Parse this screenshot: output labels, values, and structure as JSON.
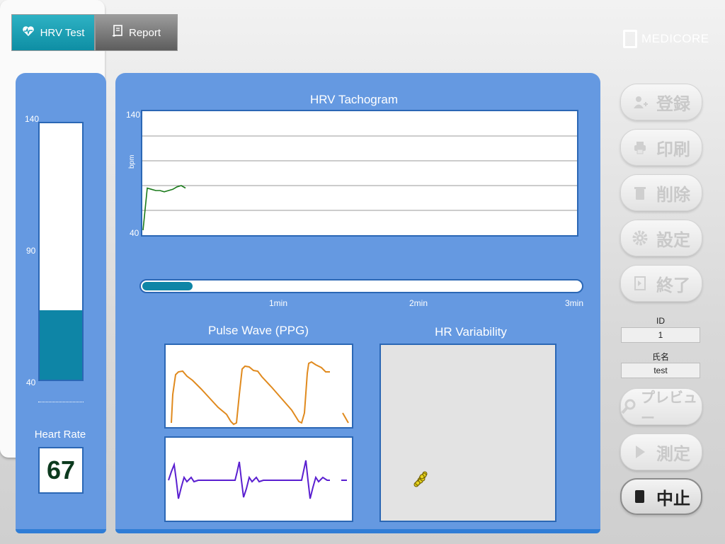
{
  "tabs": [
    {
      "label": "HRV Test",
      "icon": "heart-pulse-icon",
      "active": true
    },
    {
      "label": "Report",
      "icon": "document-icon",
      "active": false
    }
  ],
  "brand": {
    "name": "MEDICORE"
  },
  "heart_rate_panel": {
    "scale_max": "140",
    "scale_mid": "90",
    "scale_min": "40",
    "title": "Heart Rate",
    "value": "67",
    "gauge_level_bpm": 67
  },
  "tachogram": {
    "title": "HRV Tachogram",
    "ylabel": "bpm",
    "ymax": "140",
    "ymin": "40",
    "series_bpm": [
      44,
      78,
      77,
      76,
      76,
      75,
      76,
      77,
      79,
      80,
      78
    ]
  },
  "progress": {
    "fraction": 0.12,
    "ticks": [
      "1min",
      "2min",
      "3min"
    ]
  },
  "pulse_wave": {
    "title": "Pulse Wave (PPG)"
  },
  "hr_variability": {
    "title": "HR Variability"
  },
  "buttons": [
    {
      "label": "登録",
      "icon": "user-add-icon",
      "enabled": false
    },
    {
      "label": "印刷",
      "icon": "printer-icon",
      "enabled": false
    },
    {
      "label": "削除",
      "icon": "trash-icon",
      "enabled": false
    },
    {
      "label": "設定",
      "icon": "gear-icon",
      "enabled": false
    },
    {
      "label": "終了",
      "icon": "exit-icon",
      "enabled": false
    }
  ],
  "patient": {
    "id_label": "ID",
    "id_value": "1",
    "name_label": "氏名",
    "name_value": "test"
  },
  "actions": [
    {
      "label": "プレビュー",
      "icon": "magnifier-icon",
      "enabled": false
    },
    {
      "label": "測定",
      "icon": "play-icon",
      "enabled": false
    },
    {
      "label": "中止",
      "icon": "stop-icon",
      "enabled": true
    }
  ],
  "colors": {
    "panel_blue": "#6599e1",
    "accent_teal": "#0e85a6",
    "tacho_line": "#1a7a1a",
    "ppg_line": "#e08a1e",
    "ecg_line": "#5a1fd0",
    "scatter_point": "#e6d21c"
  }
}
